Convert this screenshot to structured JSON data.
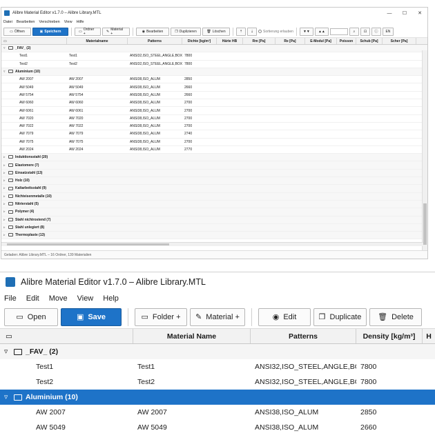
{
  "app_title": "Alibre Material Editor v1.7.0  –  Alibre Library.MTL",
  "small": {
    "menu": [
      "Datei",
      "Bearbeiten",
      "Verschieben",
      "View",
      "Hilfe"
    ],
    "toolbar": {
      "open": "Öffnen",
      "save": "Speichern",
      "folder": "Ordner +",
      "material": "Material +",
      "edit": "Bearbeiten",
      "duplicate": "Duplizieren",
      "delete": "Löschen",
      "sort": "Sortierung erlauben",
      "lang": "EN"
    },
    "columns": [
      "Materialname",
      "Patterns",
      "Dichte [kg/m³]",
      "Härte HB",
      "Rm [Pa]",
      "Re [Pa]",
      "E-Modul [Pa]",
      "Poisson",
      "Schub [Pa]",
      "Scher [Pa]"
    ],
    "groups": [
      {
        "label": "_FAV_  (2)",
        "expanded": true,
        "rows": [
          {
            "name": "Test1",
            "mat": "Test1",
            "pat": "ANSI32,ISO_STEEL,ANGLE,BOX",
            "den": "7800"
          },
          {
            "name": "Test2",
            "mat": "Test2",
            "pat": "ANSI32,ISO_STEEL,ANGLE,BOX",
            "den": "7800"
          }
        ]
      },
      {
        "label": "Aluminium  (10)",
        "expanded": true,
        "rows": [
          {
            "name": "AW 2007",
            "mat": "AW 2007",
            "pat": "ANSI38,ISO_ALUM",
            "den": "2850"
          },
          {
            "name": "AW 5049",
            "mat": "AW 5049",
            "pat": "ANSI38,ISO_ALUM",
            "den": "2660"
          },
          {
            "name": "AW 5754",
            "mat": "AW 5754",
            "pat": "ANSI38,ISO_ALUM",
            "den": "2660"
          },
          {
            "name": "AW 6060",
            "mat": "AW 6060",
            "pat": "ANSI38,ISO_ALUM",
            "den": "2700"
          },
          {
            "name": "AW 6061",
            "mat": "AW 6061",
            "pat": "ANSI38,ISO_ALUM",
            "den": "2700"
          },
          {
            "name": "AW 7020",
            "mat": "AW 7020",
            "pat": "ANSI38,ISO_ALUM",
            "den": "2700"
          },
          {
            "name": "AW 7022",
            "mat": "AW 7022",
            "pat": "ANSI38,ISO_ALUM",
            "den": "2700"
          },
          {
            "name": "AW 7079",
            "mat": "AW 7079",
            "pat": "ANSI38,ISO_ALUM",
            "den": "2740"
          },
          {
            "name": "AW 7075",
            "mat": "AW 7075",
            "pat": "ANSI38,ISO_ALUM",
            "den": "2700"
          },
          {
            "name": "AW 2024",
            "mat": "AW 2024",
            "pat": "ANSI38,ISO_ALUM",
            "den": "2770"
          }
        ]
      },
      {
        "label": "Induktionsstahl  (20)",
        "expanded": false,
        "rows": []
      },
      {
        "label": "Elastomere  (7)",
        "expanded": false,
        "rows": []
      },
      {
        "label": "Einsatzstahl  (13)",
        "expanded": false,
        "rows": []
      },
      {
        "label": "Holz  (10)",
        "expanded": false,
        "rows": []
      },
      {
        "label": "Kaltarbeitsstahl  (9)",
        "expanded": false,
        "rows": []
      },
      {
        "label": "Nichteisenmetalle  (10)",
        "expanded": false,
        "rows": []
      },
      {
        "label": "Nitrierstahl  (5)",
        "expanded": false,
        "rows": []
      },
      {
        "label": "Polymer  (4)",
        "expanded": false,
        "rows": []
      },
      {
        "label": "Stahl nichtrostend  (7)",
        "expanded": false,
        "rows": []
      },
      {
        "label": "Stahl unlegiert  (8)",
        "expanded": false,
        "rows": []
      },
      {
        "label": "Thermoplaste  (13)",
        "expanded": false,
        "rows": []
      }
    ],
    "status": "Geladen: Alibre Library.MTL  –  16 Ordner, 139 Materialien"
  },
  "zoom": {
    "menu": [
      "File",
      "Edit",
      "Move",
      "View",
      "Help"
    ],
    "toolbar": {
      "open": "Open",
      "save": "Save",
      "folder": "Folder +",
      "material": "Material +",
      "edit": "Edit",
      "duplicate": "Duplicate",
      "delete": "Delete"
    },
    "columns": [
      "Material Name",
      "Patterns",
      "Density [kg/m³]",
      "H"
    ],
    "groups": [
      {
        "label": "_FAV_  (2)",
        "selected": false,
        "rows": [
          {
            "name": "Test1",
            "mat": "Test1",
            "pat": "ANSI32,ISO_STEEL,ANGLE,BOX",
            "den": "7800"
          },
          {
            "name": "Test2",
            "mat": "Test2",
            "pat": "ANSI32,ISO_STEEL,ANGLE,BOX",
            "den": "7800"
          }
        ]
      },
      {
        "label": "Aluminium  (10)",
        "selected": true,
        "rows": [
          {
            "name": "AW 2007",
            "mat": "AW 2007",
            "pat": "ANSI38,ISO_ALUM",
            "den": "2850"
          },
          {
            "name": "AW 5049",
            "mat": "AW 5049",
            "pat": "ANSI38,ISO_ALUM",
            "den": "2660"
          }
        ]
      }
    ]
  },
  "colors": {
    "accent": "#1e73c8",
    "selected_row": "#1e73c8"
  }
}
